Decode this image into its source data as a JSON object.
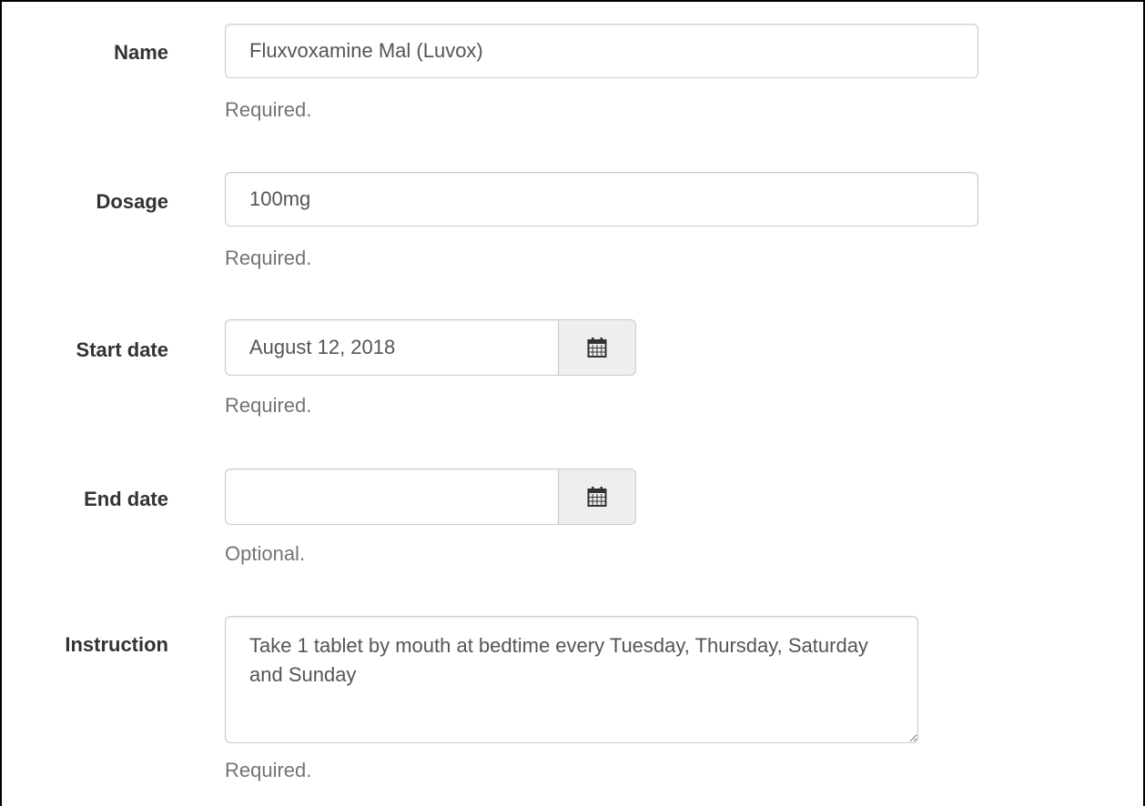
{
  "form": {
    "name": {
      "label": "Name",
      "value": "Fluxvoxamine Mal (Luvox)",
      "help": "Required."
    },
    "dosage": {
      "label": "Dosage",
      "value": "100mg",
      "help": "Required."
    },
    "start_date": {
      "label": "Start date",
      "value": "August 12, 2018",
      "help": "Required.",
      "icon": "calendar-icon"
    },
    "end_date": {
      "label": "End date",
      "value": "",
      "help": "Optional.",
      "icon": "calendar-icon"
    },
    "instruction": {
      "label": "Instruction",
      "value": "Take 1 tablet by mouth at bedtime every Tuesday, Thursday, Saturday and Sunday",
      "help": "Required."
    }
  },
  "colors": {
    "label": "#333333",
    "help_text": "#737373",
    "input_border": "#cccccc",
    "addon_background": "#eeeeee"
  }
}
